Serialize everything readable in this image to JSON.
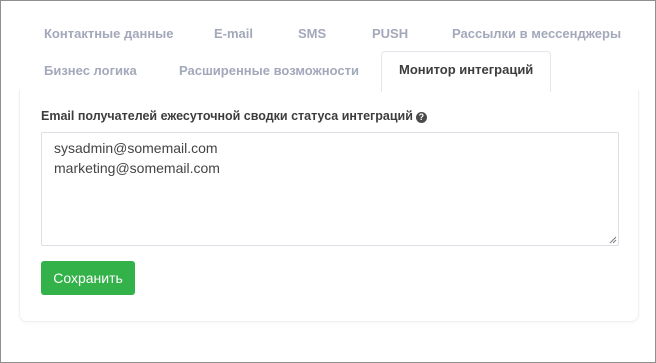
{
  "tabs": {
    "row1": [
      {
        "label": "Контактные данные"
      },
      {
        "label": "E-mail"
      },
      {
        "label": "SMS"
      },
      {
        "label": "PUSH"
      },
      {
        "label": "Рассылки в мессенджеры"
      }
    ],
    "row2": [
      {
        "label": "Бизнес логика"
      },
      {
        "label": "Расширенные возможности"
      },
      {
        "label": "Монитор интеграций",
        "active": true
      }
    ]
  },
  "form": {
    "field_label": "Email получателей ежесуточной сводки статуса интеграций",
    "help_icon": "question-circle-icon",
    "help_glyph": "?",
    "recipients": [
      "sysadmin@somemail.com",
      "marketing@somemail.com"
    ],
    "save_label": "Сохранить"
  },
  "colors": {
    "accent_green": "#33b24a",
    "tab_inactive": "#a3a8ba",
    "tab_active": "#3d3d3d"
  }
}
